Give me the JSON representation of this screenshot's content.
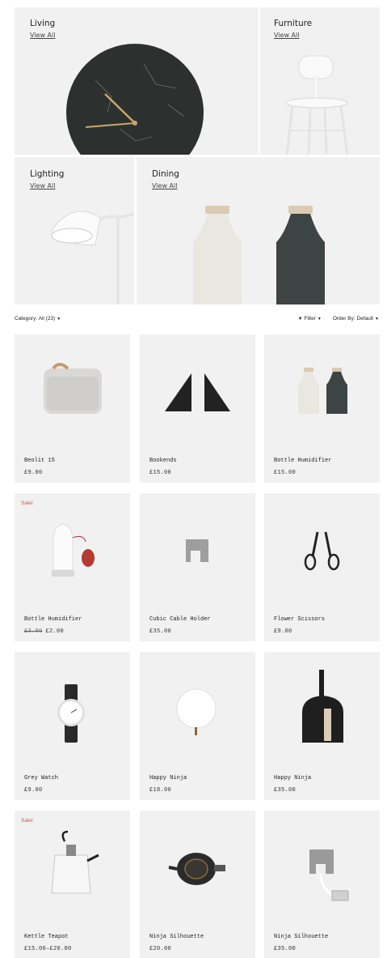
{
  "categories": [
    {
      "title": "Living",
      "link": "View All"
    },
    {
      "title": "Furniture",
      "link": "View All"
    },
    {
      "title": "Lighting",
      "link": "View All"
    },
    {
      "title": "Dining",
      "link": "View All"
    }
  ],
  "filter_bar": {
    "category": "Category: All (23)",
    "filter": "Filter",
    "order": "Order By: Default"
  },
  "products": [
    {
      "name": "Beolit 15",
      "price": "£9.00",
      "icon": "speaker-icon"
    },
    {
      "name": "Bookends",
      "price": "£15.00",
      "icon": "bookends-icon"
    },
    {
      "name": "Bottle Humidifier",
      "price": "£15.00",
      "icon": "bottles-icon"
    },
    {
      "name": "Bottle Humidifier",
      "old_price": "£3.00",
      "price": "£2.00",
      "sale": "Sale!",
      "icon": "humidifier-icon"
    },
    {
      "name": "Cubic Cable Holder",
      "price": "£35.00",
      "icon": "cable-holder-icon"
    },
    {
      "name": "Flower Scissors",
      "price": "£9.00",
      "icon": "scissors-icon"
    },
    {
      "name": "Grey Watch",
      "price": "£9.00",
      "icon": "watch-icon"
    },
    {
      "name": "Happy Ninja",
      "price": "£18.00",
      "icon": "white-ball-icon"
    },
    {
      "name": "Happy Ninja",
      "price": "£35.00",
      "icon": "dustpan-icon"
    },
    {
      "name": "Kettle Teapot",
      "price": "£15.00–£20.00",
      "sale": "Sale!",
      "icon": "teapot-icon"
    },
    {
      "name": "Ninja Silhouette",
      "price": "£20.00",
      "icon": "teapot-dark-icon"
    },
    {
      "name": "Ninja Silhouette",
      "price": "£35.00",
      "icon": "usb-cube-icon"
    }
  ]
}
